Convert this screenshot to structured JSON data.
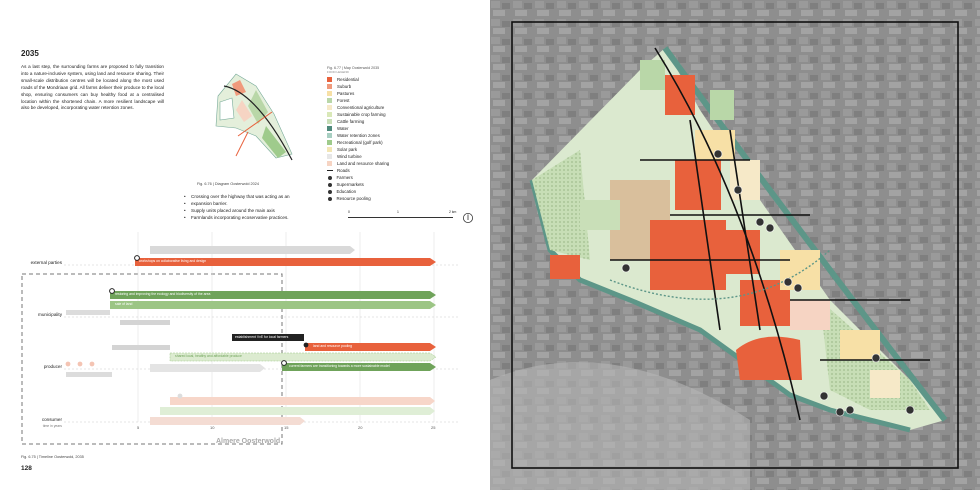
{
  "left_page": {
    "year_heading": "2035",
    "paragraph": "As a last step, the surrounding farms are proposed to fully transition into a nature-inclusive system, using land and resource sharing. Their small-scale distribution centres will be located along the most used roads of the Mondriaan grid. All farms deliver their produce to the local shop, ensuring consumers can buy healthy food at a centralised location within the shortened chain. A more resilient landscape will also be developed, incorporating water retention zones.",
    "diagram_caption": "Fig. 6.76 | Diagram Oosterwold 2024",
    "bullets": [
      "Crossing over the highway that was acting as an",
      "expansion barrier.",
      "Supply units placed around the main axis",
      "Farmlands incorporating ecoservative practices."
    ],
    "map_caption": "Fig. 6.77 | Map Oosterwold 2035",
    "legend_heading": "FOOD LEGEND",
    "legend": [
      {
        "label": "Residential",
        "color": "#e8613c"
      },
      {
        "label": "Suburb",
        "color": "#f09a7c"
      },
      {
        "label": "Pastures",
        "color": "#f7e0a6"
      },
      {
        "label": "Forest",
        "color": "#b9d7a8"
      },
      {
        "label": "Conventional agriculture",
        "color": "#f6e9c8"
      },
      {
        "label": "Sustainable crop farming",
        "color": "#d9e8b8"
      },
      {
        "label": "Cattle farming",
        "color": "#c9dfb8"
      },
      {
        "label": "Water",
        "color": "#4f8a7c"
      },
      {
        "label": "Water retention zones",
        "color": "#a8cfc2"
      },
      {
        "label": "Recreational (golf park)",
        "color": "#9fcb8c"
      },
      {
        "label": "Solar park",
        "color": "#f3e6b5"
      },
      {
        "label": "Wind turbine",
        "color": "#e7e7e7"
      },
      {
        "label": "Land and resource sharing",
        "color": "#f6d4c3"
      },
      {
        "label": "Roads",
        "color": "line"
      },
      {
        "label": "Farmers",
        "color": "dot"
      },
      {
        "label": "Supermarkets",
        "color": "dot"
      },
      {
        "label": "Education",
        "color": "dot"
      },
      {
        "label": "Resource pooling",
        "color": "dot"
      }
    ],
    "scale": {
      "start": "0",
      "mid": "1",
      "end": "2 km"
    },
    "timeline": {
      "rows": [
        "external parties",
        "municipality",
        "producer",
        "consumer"
      ],
      "consumer_sub": "time in years",
      "ticks": [
        "5",
        "10",
        "15",
        "20",
        "25"
      ],
      "footer_label": "Almere Oosterwold",
      "bars": [
        {
          "text": "workshops on collaborative living and design",
          "color": "#e8613c"
        },
        {
          "text": "restoring and improving the ecology and biodiversity of the area",
          "color": "#6fa35a"
        },
        {
          "text": "sale of land",
          "color": "#9cc585"
        },
        {
          "text": "establishment VvE for local farmers",
          "color": "#222"
        },
        {
          "text": "land and resource pooling",
          "color": "#e8613c"
        },
        {
          "text": "shared local, healthy and affordable produce",
          "color": "#b9d7a8"
        },
        {
          "text": "current farmers are transitioning towards a more sustainable model",
          "color": "#6fa35a"
        }
      ],
      "caption": "Fig. 6.75 | Timeline Oosterwold, 2035"
    },
    "page_number": "128"
  }
}
